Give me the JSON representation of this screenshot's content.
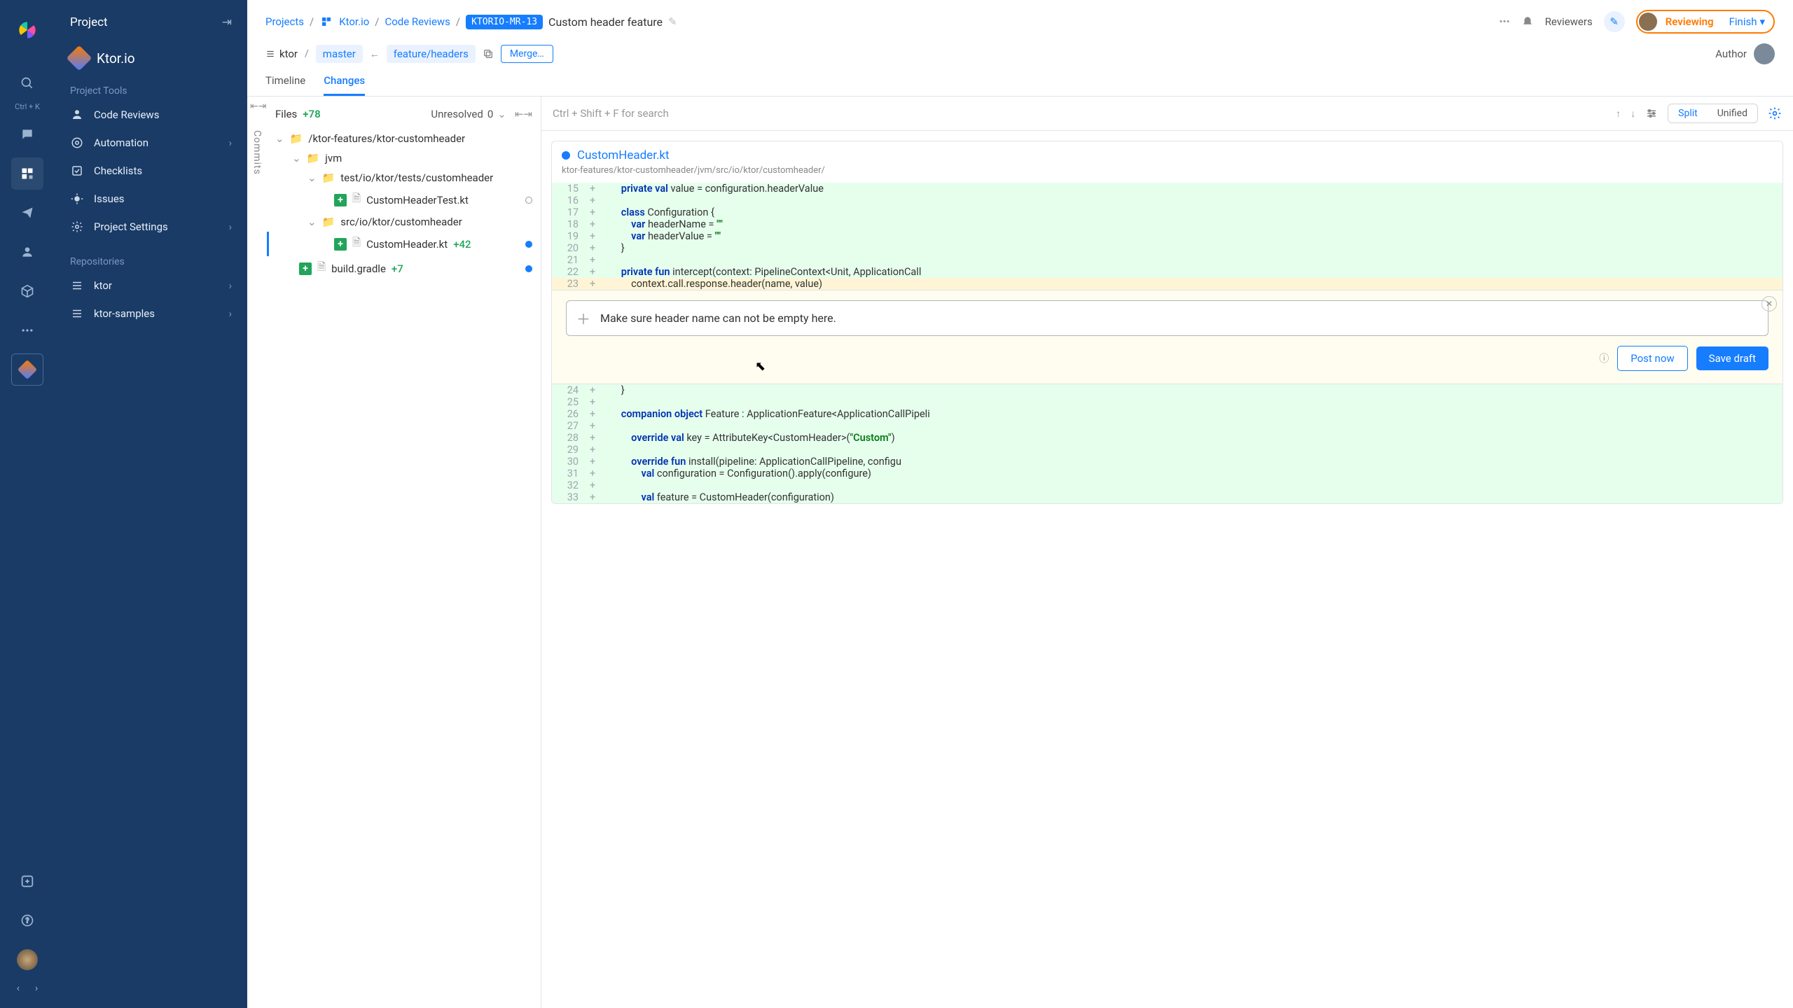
{
  "narrow_nav": {
    "shortcut": "Ctrl + K"
  },
  "sidebar": {
    "header": "Project",
    "project_name": "Ktor.io",
    "tools_label": "Project Tools",
    "items": [
      {
        "label": "Code Reviews"
      },
      {
        "label": "Automation"
      },
      {
        "label": "Checklists"
      },
      {
        "label": "Issues"
      },
      {
        "label": "Project Settings"
      }
    ],
    "repos_label": "Repositories",
    "repos": [
      {
        "label": "ktor"
      },
      {
        "label": "ktor-samples"
      }
    ]
  },
  "breadcrumbs": {
    "projects": "Projects",
    "project": "Ktor.io",
    "section": "Code Reviews",
    "mr_id": "KTORIO-MR-13",
    "title": "Custom header feature"
  },
  "header": {
    "reviewers": "Reviewers",
    "reviewing": "Reviewing",
    "finish": "Finish"
  },
  "branch_row": {
    "repo": "ktor",
    "target": "master",
    "source": "feature/headers",
    "merge": "Merge…",
    "author_label": "Author"
  },
  "tabs": {
    "timeline": "Timeline",
    "changes": "Changes"
  },
  "files": {
    "label": "Files",
    "count": "+78",
    "unresolved_label": "Unresolved",
    "unresolved_count": "0",
    "commits": "Commits",
    "tree": {
      "root": "/ktor-features/ktor-customheader",
      "jvm": "jvm",
      "test_path": "test/io/ktor/tests/customheader",
      "test_file": "CustomHeaderTest.kt",
      "src_path": "src/io/ktor/customheader",
      "src_file": "CustomHeader.kt",
      "src_changes": "+42",
      "build": "build.gradle",
      "build_changes": "+7"
    }
  },
  "toolbar": {
    "search_hint": "Ctrl + Shift + F for search",
    "split": "Split",
    "unified": "Unified"
  },
  "file_view": {
    "name": "CustomHeader.kt",
    "path": "ktor-features/ktor-customheader/jvm/src/io/ktor/customheader/"
  },
  "code_lines": [
    {
      "n": 15,
      "html": "    <span class='kw'>private</span> <span class='kw'>val</span> value = configuration.headerValue"
    },
    {
      "n": 16,
      "html": ""
    },
    {
      "n": 17,
      "html": "    <span class='kw'>class</span> Configuration {"
    },
    {
      "n": 18,
      "html": "        <span class='kw'>var</span> headerName = <span class='str'>\"\"</span>"
    },
    {
      "n": 19,
      "html": "        <span class='kw'>var</span> headerValue = <span class='str'>\"\"</span>"
    },
    {
      "n": 20,
      "html": "    }"
    },
    {
      "n": 21,
      "html": ""
    },
    {
      "n": 22,
      "html": "    <span class='kw'>private</span> <span class='kw'>fun</span> intercept(context: PipelineContext&lt;Unit, ApplicationCall"
    },
    {
      "n": 23,
      "html": "        context.call.response.header(name, value)",
      "hl": true
    }
  ],
  "code_lines_after": [
    {
      "n": 24,
      "html": "    }"
    },
    {
      "n": 25,
      "html": ""
    },
    {
      "n": 26,
      "html": "    <span class='kw'>companion</span> <span class='kw'>object</span> Feature : ApplicationFeature&lt;ApplicationCallPipeli"
    },
    {
      "n": 27,
      "html": ""
    },
    {
      "n": 28,
      "html": "        <span class='kw'>override</span> <span class='kw'>val</span> key = AttributeKey&lt;CustomHeader&gt;(<span class='str'>\"Custom\"</span>)"
    },
    {
      "n": 29,
      "html": ""
    },
    {
      "n": 30,
      "html": "        <span class='kw'>override</span> <span class='kw'>fun</span> install(pipeline: ApplicationCallPipeline, configu"
    },
    {
      "n": 31,
      "html": "            <span class='kw'>val</span> configuration = Configuration().apply(configure)"
    },
    {
      "n": 32,
      "html": ""
    },
    {
      "n": 33,
      "html": "            <span class='kw'>val</span> feature = CustomHeader(configuration)"
    }
  ],
  "comment": {
    "text": "Make sure header name can not be empty here.",
    "post": "Post now",
    "draft": "Save draft"
  }
}
